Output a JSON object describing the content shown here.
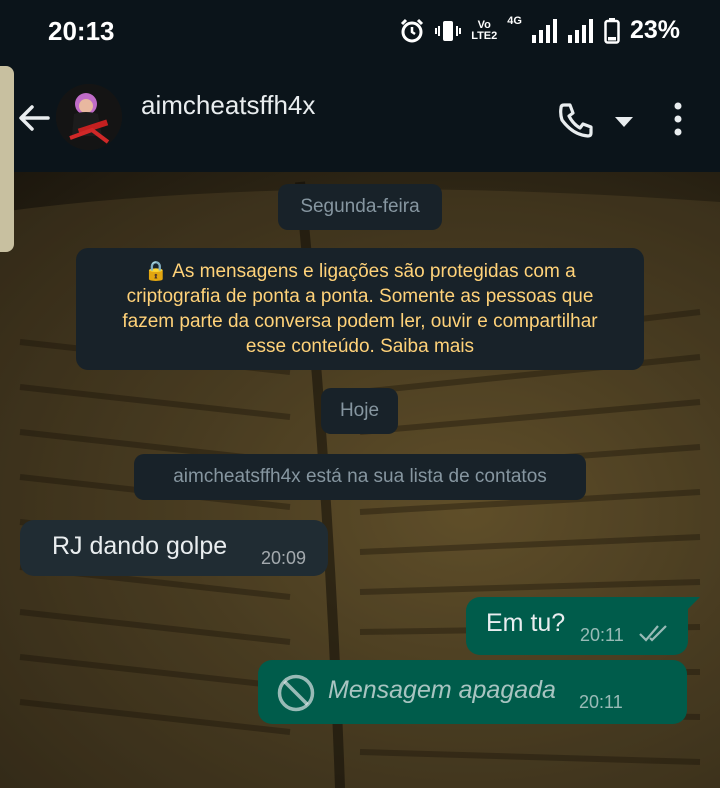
{
  "status_bar": {
    "time": "20:13",
    "network_vo": "Vo",
    "network_lte": "LTE2",
    "network_4g": "4G",
    "battery_percent": "23%"
  },
  "header": {
    "contact_name": "aimcheatsffh4x"
  },
  "chat": {
    "date_monday": "Segunda-feira",
    "encryption_lines": [
      "🔒 As mensagens e ligações são protegidas com a",
      "criptografia de ponta a ponta. Somente as pessoas que",
      "fazem parte da conversa podem ler, ouvir e compartilhar",
      "esse conteúdo. Saiba mais"
    ],
    "date_today": "Hoje",
    "contact_notice": "aimcheatsffh4x está na sua lista de contatos",
    "messages": [
      {
        "direction": "in",
        "text": "RJ dando golpe",
        "time": "20:09"
      },
      {
        "direction": "out",
        "text": "Em tu?",
        "time": "20:11",
        "status": "read"
      },
      {
        "direction": "out",
        "text": "Mensagem apagada",
        "time": "20:11",
        "deleted": true
      }
    ]
  },
  "colors": {
    "header_bg": "#0b141a",
    "incoming_bubble": "#202c33",
    "outgoing_bubble": "#005c4b",
    "encryption_text": "#ffd279",
    "system_pill": "#182229"
  },
  "icons": [
    "back-arrow-icon",
    "call-icon",
    "chevron-down-icon",
    "more-vert-icon",
    "check-double-icon",
    "block-icon",
    "lock-icon",
    "alarm-icon",
    "vibrate-icon",
    "signal-icon",
    "battery-icon"
  ]
}
